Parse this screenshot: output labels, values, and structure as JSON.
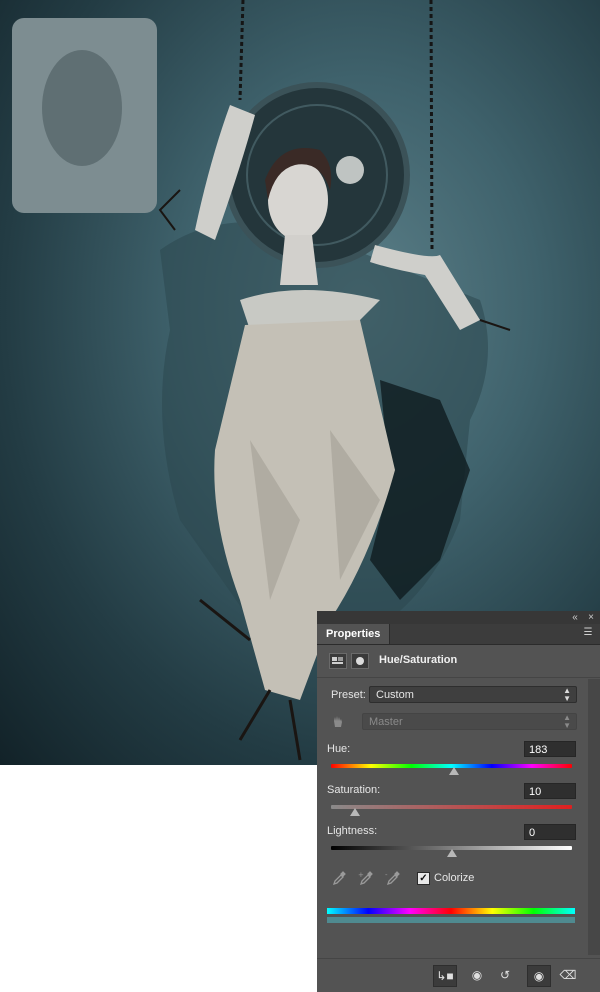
{
  "panel": {
    "tab_label": "Properties",
    "title": "Hue/Saturation",
    "preset_label": "Preset:",
    "preset_value": "Custom",
    "channel_value": "Master",
    "hue_label": "Hue:",
    "hue_value": "183",
    "hue_level": 0.51,
    "saturation_label": "Saturation:",
    "saturation_value": "10",
    "saturation_level": 0.1,
    "lightness_label": "Lightness:",
    "lightness_value": "0",
    "lightness_level": 0.5,
    "colorize_label": "Colorize",
    "colorize_checked": true
  },
  "icons": {
    "collapse": "double-chevron-icon",
    "close": "close-icon",
    "menu": "panel-menu-icon",
    "adjustment": "adjustment-layer-icon",
    "mask": "layer-mask-icon",
    "hand": "targeted-adjustment-hand-icon",
    "eyedropper": "eyedropper-icon",
    "eyedropper_plus": "eyedropper-add-icon",
    "eyedropper_minus": "eyedropper-subtract-icon",
    "clip": "clip-to-layer-icon",
    "view_previous": "view-previous-state-icon",
    "reset": "reset-icon",
    "visibility": "eye-icon",
    "delete": "trash-icon"
  },
  "colors": {
    "panel_bg": "#535353",
    "canvas_teal": "#3f626c",
    "colorize_tint": "#4f8a90"
  }
}
